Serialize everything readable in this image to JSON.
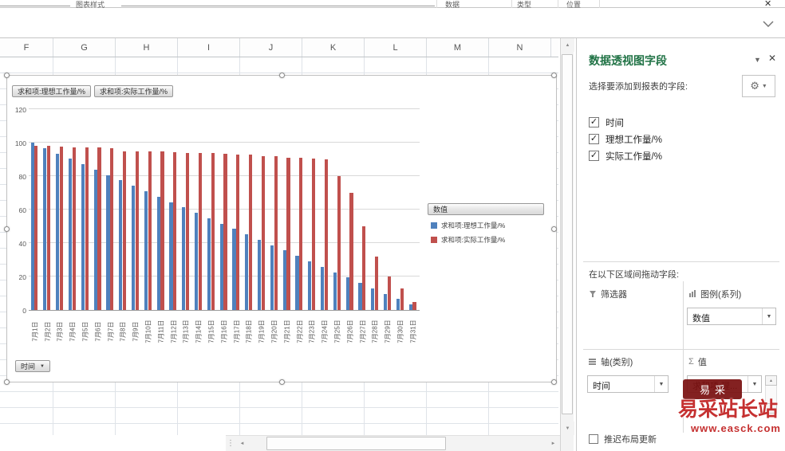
{
  "ribbon": {
    "groups": [
      "图表样式",
      "数据",
      "类型",
      "位置"
    ]
  },
  "sheet": {
    "columns": [
      "F",
      "G",
      "H",
      "I",
      "J",
      "K",
      "L",
      "M",
      "N"
    ]
  },
  "chart_ui": {
    "legend_button": "数值",
    "axis_button": "时间"
  },
  "chart_data": {
    "type": "bar",
    "title": "",
    "xlabel": "时间",
    "ylabel": "",
    "ylim": [
      0,
      120
    ],
    "yticks": [
      0,
      20,
      40,
      60,
      80,
      100,
      120
    ],
    "grid": true,
    "legend_position": "right",
    "legend_title": "数值",
    "categories": [
      "7月1日",
      "7月2日",
      "7月3日",
      "7月4日",
      "7月5日",
      "7月6日",
      "7月7日",
      "7月8日",
      "7月9日",
      "7月10日",
      "7月11日",
      "7月12日",
      "7月13日",
      "7月14日",
      "7月15日",
      "7月16日",
      "7月17日",
      "7月18日",
      "7月19日",
      "7月20日",
      "7月21日",
      "7月22日",
      "7月23日",
      "7月24日",
      "7月25日",
      "7月26日",
      "7月27日",
      "7月28日",
      "7月29日",
      "7月30日",
      "7月31日"
    ],
    "series": [
      {
        "name": "求和项:理想工作量/%",
        "color": "#4F81BD",
        "values": [
          100,
          96.8,
          93.5,
          90.3,
          87.1,
          83.9,
          80.6,
          77.4,
          74.2,
          71,
          67.7,
          64.5,
          61.3,
          58.1,
          54.8,
          51.6,
          48.4,
          45.2,
          41.9,
          38.7,
          35.5,
          32.3,
          29,
          25.8,
          22.6,
          19.4,
          16.1,
          12.9,
          9.7,
          6.5,
          3.2
        ]
      },
      {
        "name": "求和项:实际工作量/%",
        "color": "#C0504D",
        "values": [
          98,
          98,
          97.5,
          97,
          97,
          97,
          96.5,
          95,
          95,
          95,
          95,
          94.5,
          94,
          94,
          94,
          93.5,
          93,
          93,
          92,
          92,
          91,
          91,
          90.5,
          90,
          80,
          70,
          50,
          32,
          20,
          13,
          5
        ]
      }
    ]
  },
  "pane": {
    "title": "数据透视图字段",
    "subtitle": "选择要添加到报表的字段:",
    "fields": [
      {
        "label": "时间",
        "checked": true
      },
      {
        "label": "理想工作量/%",
        "checked": true
      },
      {
        "label": "实际工作量/%",
        "checked": true
      }
    ],
    "drag_label": "在以下区域间拖动字段:",
    "areas": {
      "filters": {
        "label": "筛选器",
        "items": []
      },
      "legend": {
        "label": "图例(系列)",
        "items": [
          "数值"
        ]
      },
      "axis": {
        "label": "轴(类别)",
        "items": [
          "时间"
        ]
      },
      "values": {
        "label": "值",
        "sigma": "Σ",
        "items": [
          "求和项:理..."
        ]
      }
    },
    "defer_label": "推迟布局更新"
  },
  "watermark": {
    "badge": "易采",
    "brand": "易采站长站",
    "url": "www.easck.com"
  }
}
